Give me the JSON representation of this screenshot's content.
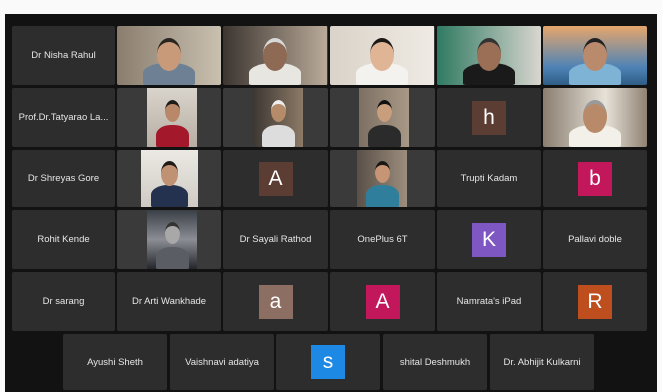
{
  "meeting": {
    "rows": [
      [
        {
          "id": "r1c1",
          "type": "name",
          "label": "Dr Nisha Rahul"
        },
        {
          "id": "r1c2",
          "type": "video"
        },
        {
          "id": "r1c3",
          "type": "video"
        },
        {
          "id": "r1c4",
          "type": "video"
        },
        {
          "id": "r1c5",
          "type": "video"
        },
        {
          "id": "r1c6",
          "type": "video"
        }
      ],
      [
        {
          "id": "r2c1",
          "type": "name",
          "label": "Prof.Dr.Tatyarao La..."
        },
        {
          "id": "r2c2",
          "type": "video"
        },
        {
          "id": "r2c3",
          "type": "video"
        },
        {
          "id": "r2c4",
          "type": "video"
        },
        {
          "id": "r2c5",
          "type": "avatar",
          "letter": "h",
          "color": "#5c3d34"
        },
        {
          "id": "r2c6",
          "type": "video"
        }
      ],
      [
        {
          "id": "r3c1",
          "type": "name",
          "label": "Dr Shreyas Gore"
        },
        {
          "id": "r3c2",
          "type": "video"
        },
        {
          "id": "r3c3",
          "type": "avatar",
          "letter": "A",
          "color": "#5c3d34"
        },
        {
          "id": "r3c4",
          "type": "video"
        },
        {
          "id": "r3c5",
          "type": "name",
          "label": "Trupti Kadam"
        },
        {
          "id": "r3c6",
          "type": "avatar",
          "letter": "b",
          "color": "#c2185b"
        }
      ],
      [
        {
          "id": "r4c1",
          "type": "name",
          "label": "Rohit Kende"
        },
        {
          "id": "r4c2",
          "type": "video"
        },
        {
          "id": "r4c3",
          "type": "name",
          "label": "Dr Sayali Rathod"
        },
        {
          "id": "r4c4",
          "type": "name",
          "label": "OnePlus 6T"
        },
        {
          "id": "r4c5",
          "type": "avatar",
          "letter": "K",
          "color": "#7e57c2"
        },
        {
          "id": "r4c6",
          "type": "name",
          "label": "Pallavi doble"
        }
      ],
      [
        {
          "id": "r5c1",
          "type": "name",
          "label": "Dr sarang"
        },
        {
          "id": "r5c2",
          "type": "name",
          "label": "Dr Arti Wankhade"
        },
        {
          "id": "r5c3",
          "type": "avatar",
          "letter": "a",
          "color": "#8d6e63"
        },
        {
          "id": "r5c4",
          "type": "avatar",
          "letter": "A",
          "color": "#c2185b"
        },
        {
          "id": "r5c5",
          "type": "name",
          "label": "Namrata's iPad"
        },
        {
          "id": "r5c6",
          "type": "avatar",
          "letter": "R",
          "color": "#bf4e1f"
        }
      ],
      [
        {
          "id": "r6c1",
          "type": "name",
          "label": "Ayushi Sheth"
        },
        {
          "id": "r6c2",
          "type": "name",
          "label": "Vaishnavi adatiya"
        },
        {
          "id": "r6c3",
          "type": "avatar",
          "letter": "s",
          "color": "#1e88e5"
        },
        {
          "id": "r6c4",
          "type": "name",
          "label": "shital Deshmukh"
        },
        {
          "id": "r6c5",
          "type": "name",
          "label": "Dr. Abhijit Kulkarni"
        }
      ]
    ]
  }
}
